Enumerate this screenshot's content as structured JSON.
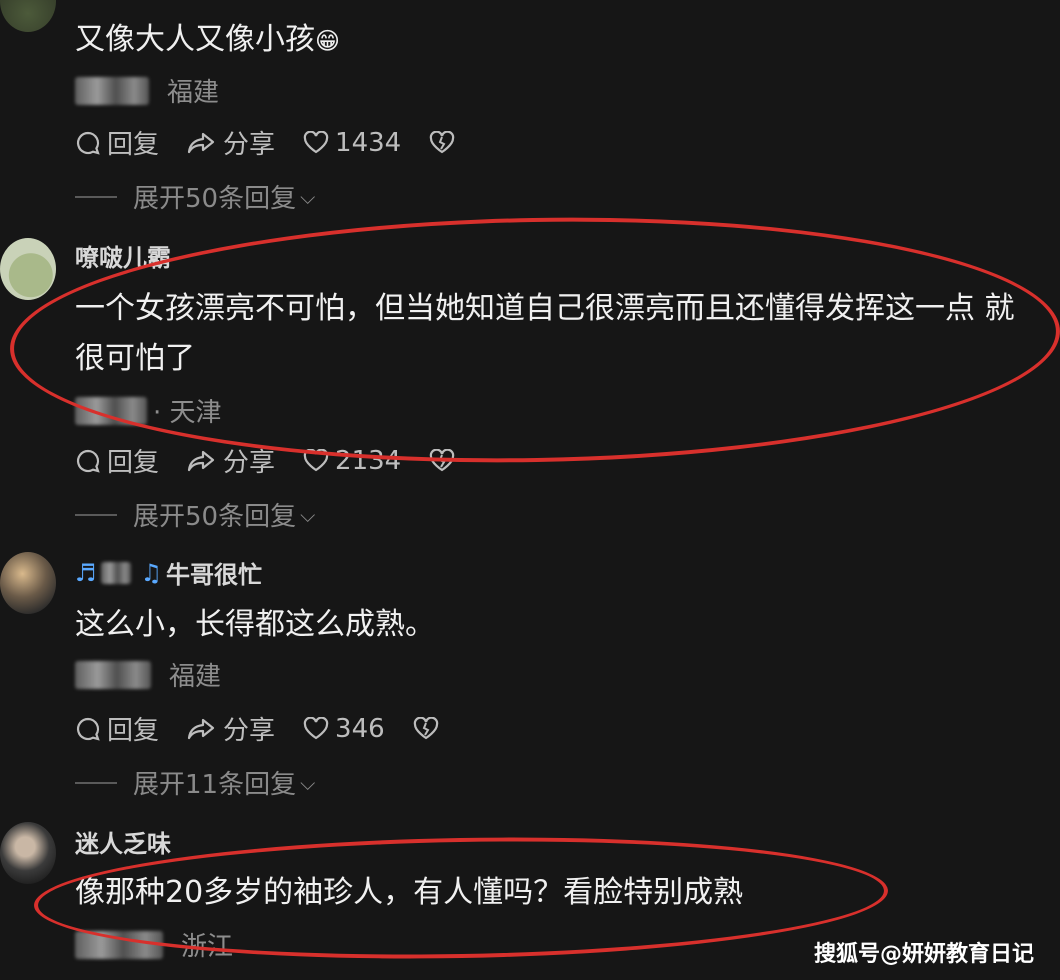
{
  "comments": [
    {
      "text": "又像大人又像小孩",
      "emoji": "😁",
      "location": "福建",
      "reply": "回复",
      "share": "分享",
      "likes": "1434",
      "expand": "展开50条回复"
    },
    {
      "username": "嘹啵儿霸",
      "text": "一个女孩漂亮不可怕，但当她知道自己很漂亮而且还懂得发挥这一点 就很可怕了",
      "location": "· 天津",
      "reply": "回复",
      "share": "分享",
      "likes": "2134",
      "expand": "展开50条回复"
    },
    {
      "username": "牛哥很忙",
      "text": "这么小，长得都这么成熟。",
      "location": "福建",
      "reply": "回复",
      "share": "分享",
      "likes": "346",
      "expand": "展开11条回复"
    },
    {
      "username": "迷人乏味",
      "text": "像那种20多岁的袖珍人，有人懂吗？看脸特别成熟",
      "location": "浙江"
    }
  ],
  "watermark": "搜狐号@妍妍教育日记",
  "colors": {
    "background": "#161616",
    "highlight_ring": "#d8302c",
    "username_badge": "#5aa9ff"
  }
}
